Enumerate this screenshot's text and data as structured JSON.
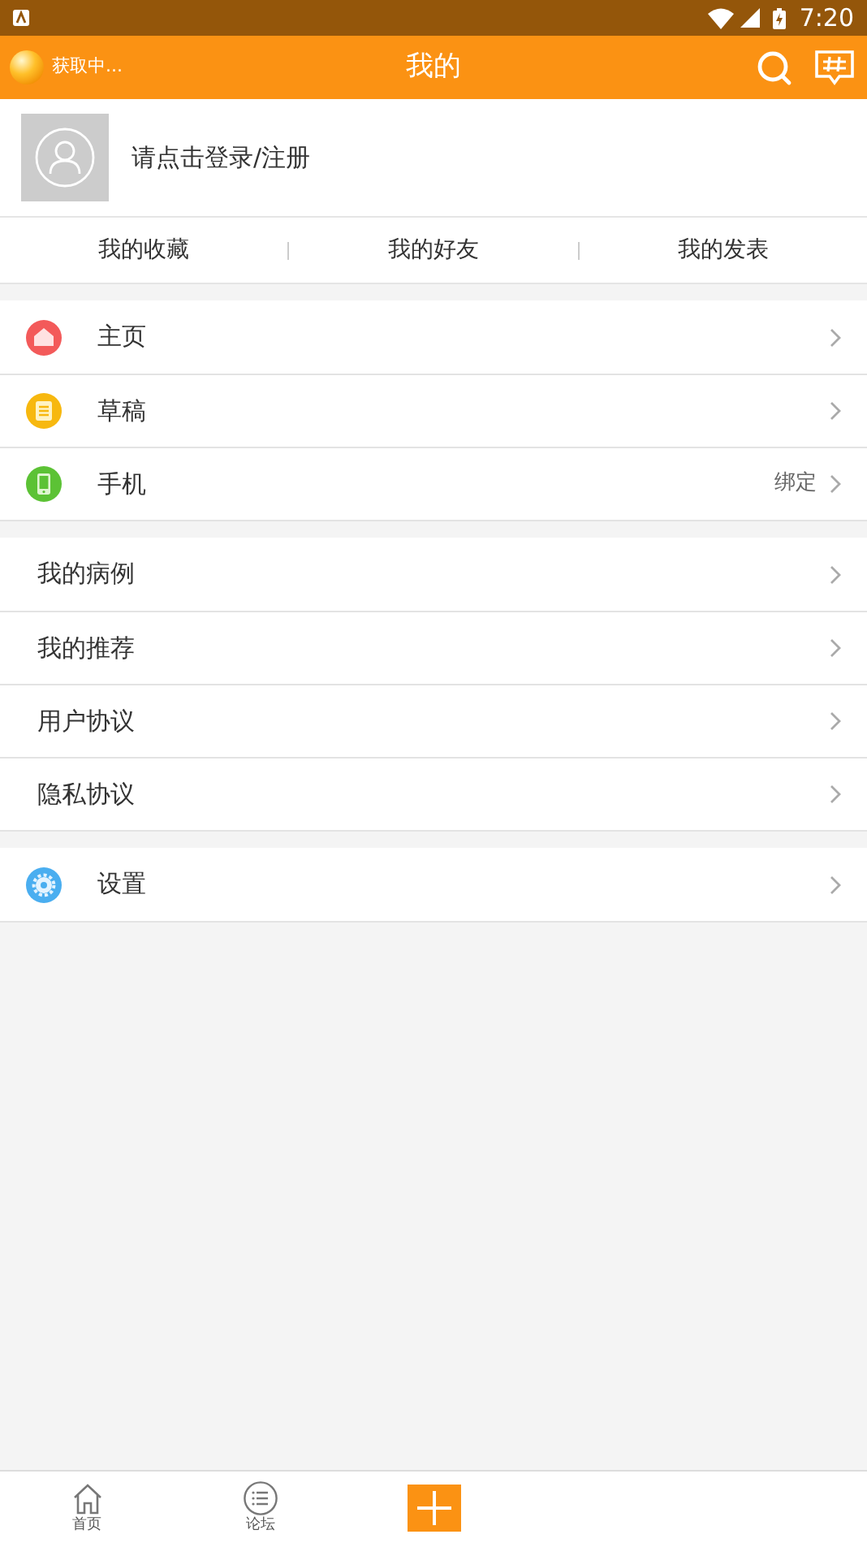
{
  "status_bar": {
    "time": "7:20"
  },
  "app_bar": {
    "location": "获取中...",
    "title": "我的"
  },
  "profile": {
    "prompt": "请点击登录/注册"
  },
  "tabs": [
    {
      "label": "我的收藏"
    },
    {
      "label": "我的好友"
    },
    {
      "label": "我的发表"
    }
  ],
  "menu_groups": [
    [
      {
        "kind": "home",
        "label": "主页"
      },
      {
        "kind": "draft",
        "label": "草稿"
      },
      {
        "kind": "phone",
        "label": "手机",
        "value": "绑定"
      }
    ],
    [
      {
        "kind": "plain",
        "label": "我的病例"
      },
      {
        "kind": "plain",
        "label": "我的推荐"
      },
      {
        "kind": "plain",
        "label": "用户协议"
      },
      {
        "kind": "plain",
        "label": "隐私协议"
      }
    ],
    [
      {
        "kind": "settings",
        "label": "设置"
      }
    ]
  ],
  "bottom_nav": [
    {
      "kind": "home",
      "label": "首页"
    },
    {
      "kind": "list",
      "label": "论坛"
    },
    {
      "kind": "plus"
    }
  ]
}
